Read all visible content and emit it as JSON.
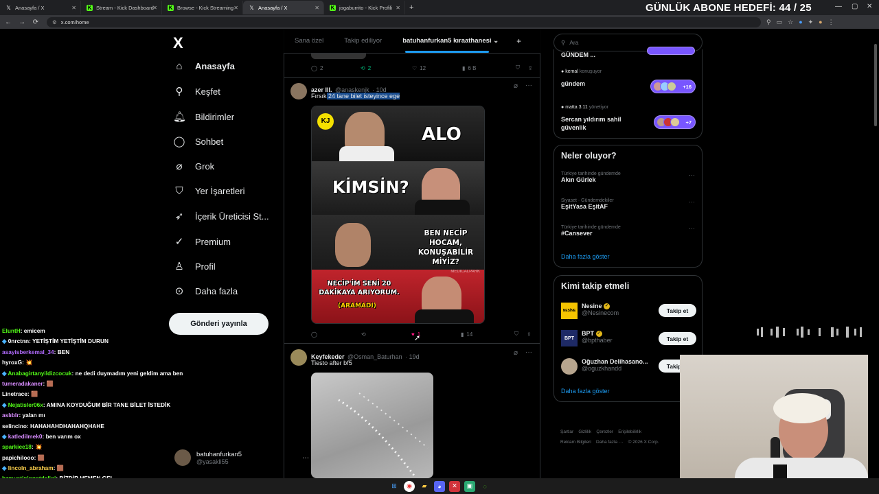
{
  "browser": {
    "tabs": [
      {
        "title": "Anasayfa / X",
        "icon": "x-icon",
        "active": false
      },
      {
        "title": "Stream - Kick Dashboard",
        "icon": "kick-icon",
        "active": false
      },
      {
        "title": "Browse - Kick Streaming",
        "icon": "kick-icon",
        "active": false
      },
      {
        "title": "Anasayfa / X",
        "icon": "x-icon",
        "active": true
      },
      {
        "title": "jogaburrito - Kick Profili",
        "icon": "kick-icon",
        "active": false
      }
    ],
    "url": "x.com/home",
    "overlay_goal": "GÜNLÜK ABONE HEDEFİ: 44 / 25"
  },
  "sidebar": {
    "logo": "X",
    "items": [
      {
        "label": "Anasayfa",
        "icon": "home-icon"
      },
      {
        "label": "Keşfet",
        "icon": "search-icon"
      },
      {
        "label": "Bildirimler",
        "icon": "bell-icon"
      },
      {
        "label": "Sohbet",
        "icon": "chat-icon"
      },
      {
        "label": "Grok",
        "icon": "grok-icon"
      },
      {
        "label": "Yer İşaretleri",
        "icon": "bookmark-icon"
      },
      {
        "label": "İçerik Üreticisi St...",
        "icon": "rocket-icon"
      },
      {
        "label": "Premium",
        "icon": "verified-icon"
      },
      {
        "label": "Profil",
        "icon": "person-icon"
      },
      {
        "label": "Daha fazla",
        "icon": "more-icon"
      }
    ],
    "post_button": "Gönderi yayınla",
    "account": {
      "name": "batuhanfurkan5",
      "handle": "@yasakli55",
      "more": "···"
    }
  },
  "chat": [
    {
      "user": "EluntH",
      "color": "#53fc18",
      "msg": ": emicem"
    },
    {
      "user": "0nrctnn",
      "color": "#ffffff",
      "msg": ": YETİŞTİM YETİŞTİM DURUN"
    },
    {
      "user": "asayisberkemal_34",
      "color": "#b26bff",
      "msg": ": BEN"
    },
    {
      "user": "hyroxG",
      "color": "#ffffff",
      "msg": ": 💥"
    },
    {
      "user": "Anabagirtanyildizcocuk",
      "color": "#53fc18",
      "msg": ": ne dedi duymadım yeni geldim ama ben"
    },
    {
      "user": "tumeradakaner",
      "color": "#d88cff",
      "msg": ": 🟫"
    },
    {
      "user": "Linetrace",
      "color": "#ffffff",
      "msg": ": 🟫"
    },
    {
      "user": "Nejatisler06x",
      "color": "#53fc18",
      "msg": ": AMINA KOYDUĞUM BİR TANE BİLET İSTEDİK"
    },
    {
      "user": "aslıblr",
      "color": "#d88cff",
      "msg": ": yalan mı"
    },
    {
      "user": "selincino",
      "color": "#ffffff",
      "msg": ": HAHAHAHDHAHAHQHAHE"
    },
    {
      "user": "katledilmek0",
      "color": "#d88cff",
      "msg": ": ben varım ox"
    },
    {
      "user": "sparkiee18",
      "color": "#53fc18",
      "msg": ": 💥"
    },
    {
      "user": "papichilooo",
      "color": "#ffffff",
      "msg": ": 🟫"
    },
    {
      "user": "lincoln_abraham",
      "color": "#ffd24d",
      "msg": ": 🟫"
    },
    {
      "user": "hzmustiningotdeligi",
      "color": "#53fc18",
      "msg": ": BİZDİR HEMEN GEL"
    }
  ],
  "timeline": {
    "tabs": [
      "Sana özel",
      "Takip ediliyor",
      "batuhanfurkan5 kıraathanesi"
    ],
    "add": "+",
    "prev_actions": {
      "reply": "2",
      "retweet": "2",
      "like": "12",
      "views": "6 B"
    },
    "tweet1": {
      "name": "azer III.",
      "handle": "@anaskenjk",
      "time": "· 10d",
      "text_pre": "Fırsık",
      "text_hl": " 24 tane bilet isteyince ege",
      "actions": {
        "reply": "",
        "retweet": "",
        "like": "1",
        "views": "14"
      },
      "meme": {
        "logo": "KJ",
        "t1": "ALO",
        "t2": "KİMSİN?",
        "t3": "BEN NECİP HOCAM, KONUŞABİLİR MİYİZ?",
        "t4": "NECİP'İM SENİ 20 DAKİKAYA ARIYORUM.",
        "t5": "(ARAMADI)",
        "sponsor": "MEDICALPARK"
      }
    },
    "tweet2": {
      "name": "Keyfekeder",
      "handle": "@Osman_Baturhan",
      "time": "· 19d",
      "text": "Tiesto after bf5"
    }
  },
  "right": {
    "search_placeholder": "Ara",
    "spaces": [
      {
        "host": "",
        "host_suffix": "",
        "title": "GÜNDEM ...",
        "extra": ""
      },
      {
        "host": "kemal",
        "host_suffix": "konuşuyor",
        "title": "gündem",
        "extra": "+16"
      },
      {
        "host": "matta 3:11",
        "host_suffix": "yönetiyor",
        "title": "Sercan yıldırım sahil güvenlik",
        "extra": "+7"
      }
    ],
    "trends_title": "Neler oluyor?",
    "trends": [
      {
        "cat": "Türkiye tarihinde gündemde",
        "name": "Akın Gürlek"
      },
      {
        "cat": "Siyaset · Gündemdekiler",
        "name": "EşitYasa EşitAF"
      },
      {
        "cat": "Türkiye tarihinde gündemde",
        "name": "#Cansever"
      }
    ],
    "show_more": "Daha fazla göster",
    "who_title": "Kimi takip etmeli",
    "who": [
      {
        "name": "Nesine",
        "handle": "@Nesinecom",
        "button": "Takip et",
        "avatar_text": "NESİNE"
      },
      {
        "name": "BPT",
        "handle": "@bpthaber",
        "button": "Takip et",
        "avatar_text": "BPT"
      },
      {
        "name": "Oğuzhan Delihasano...",
        "handle": "@oguzkhandd",
        "button": "Takip et",
        "avatar_text": ""
      }
    ],
    "who_more": "Daha fazla göster",
    "footer": [
      "Şartlar",
      "Gizlilik",
      "Çerezler",
      "Erişilebilirlik",
      "Reklam Bilgileri",
      "Daha fazla ···",
      "© 2026 X Corp."
    ]
  },
  "colors": {
    "accent": "#1d9bf0",
    "bg": "#000000",
    "border": "#2f3336",
    "spaces_purple": "#7856ff"
  }
}
